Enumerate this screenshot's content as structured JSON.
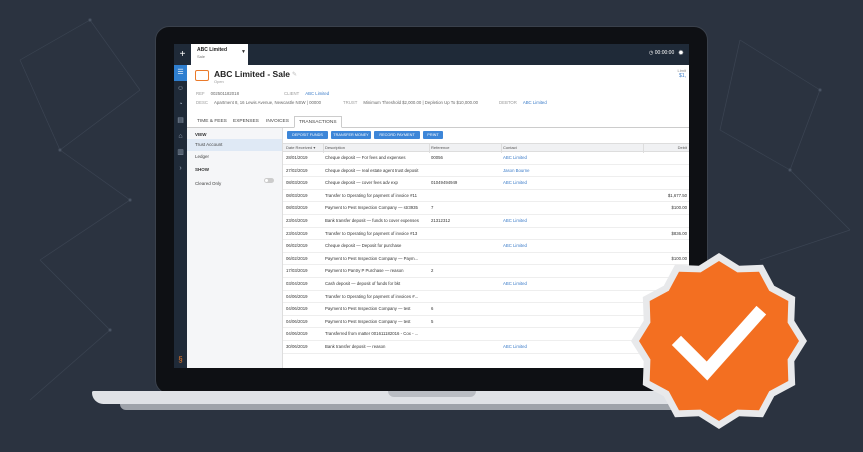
{
  "window": {
    "tab_title": "ABC Limited",
    "tab_subtitle": "Sale",
    "plus": "+",
    "timer": "00:00:00"
  },
  "icons": {
    "sidebar": [
      "list-icon",
      "contacts-icon",
      "clock-icon",
      "document-icon",
      "bank-icon",
      "chart-icon",
      "expand-icon"
    ],
    "brand": "smokeball-logo-icon",
    "verified": "checkmark-badge-icon"
  },
  "matter": {
    "title": "ABC Limited - Sale",
    "status": "Open",
    "limit_label": "Limit",
    "limit_value": "$1,",
    "ref_label": "REF",
    "ref_value": "002501182018",
    "client_label": "CLIENT",
    "client_value": "ABC Limited",
    "desc_label": "DESC",
    "desc_value": "Apartment 8, 16 Lewis Avenue, Newcastle NSW | 00000",
    "trust_label": "TRUST",
    "trust_value": "Minimum Threshold $2,000.00 | Depletion Up To $10,000.00",
    "debtor_label": "DEBTOR",
    "debtor_value": "ABC Limited"
  },
  "tabs": [
    "TIME & FEES",
    "EXPENSES",
    "INVOICES",
    "TRANSACTIONS"
  ],
  "left_panel": {
    "view_label": "VIEW",
    "view_items": [
      "Trust Account",
      "Ledger"
    ],
    "show_label": "SHOW",
    "show_items": [
      "Cleared Only"
    ]
  },
  "actions": [
    "DEPOSIT FUNDS",
    "TRANSFER MONEY",
    "RECORD PAYMENT",
    "PRINT"
  ],
  "table": {
    "headers": [
      "Date Received",
      "Description",
      "Reference",
      "Contact",
      "Debit"
    ],
    "rows": [
      [
        "28/01/2019",
        "Cheque deposit — For fees and expenses",
        "00056",
        "ABC Limited",
        ""
      ],
      [
        "27/02/2019",
        "Cheque deposit — real estate agent trust deposit",
        "",
        "Jason Bourne",
        ""
      ],
      [
        "08/03/2019",
        "Cheque deposit — cover fees adv exp",
        "01049494949",
        "ABC Limited",
        ""
      ],
      [
        "08/03/2019",
        "Transfer to Operating for payment of invoice #11",
        "",
        "",
        "$1,677.50"
      ],
      [
        "08/03/2019",
        "Payment to Pest Inspection Company — str3935",
        "7",
        "",
        "$100.00"
      ],
      [
        "23/04/2019",
        "Bank transfer deposit — funds to cover expenses",
        "21312312",
        "ABC Limited",
        ""
      ],
      [
        "23/04/2019",
        "Transfer to Operating for payment of invoice #13",
        "",
        "",
        "$836.00"
      ],
      [
        "06/02/2019",
        "Cheque deposit — Deposit for purchase",
        "",
        "ABC Limited",
        ""
      ],
      [
        "06/02/2019",
        "Payment to Pest Inspection Company — Paym...",
        "",
        "",
        "$100.00"
      ],
      [
        "17/03/2019",
        "Payment to Pantry P Purchase — reason",
        "2",
        "",
        ""
      ],
      [
        "03/04/2019",
        "Cash deposit — deposit of funds for bkt",
        "",
        "ABC Limited",
        ""
      ],
      [
        "04/06/2019",
        "Transfer to Operating for payment of invoices #...",
        "",
        "",
        ""
      ],
      [
        "04/06/2019",
        "Payment to Pest Inspection Company — test",
        "6",
        "",
        ""
      ],
      [
        "04/06/2019",
        "Payment to Pest Inspection Company — test",
        "5",
        "",
        ""
      ],
      [
        "04/06/2019",
        "Transferred from matter 001611182016 - Cox - ...",
        "",
        "",
        ""
      ],
      [
        "30/06/2019",
        "Bank transfer deposit — reason",
        "",
        "ABC Limited",
        ""
      ]
    ]
  },
  "colors": {
    "accent": "#3d86d8",
    "badge": "#f36f21",
    "background": "#2b3340"
  }
}
